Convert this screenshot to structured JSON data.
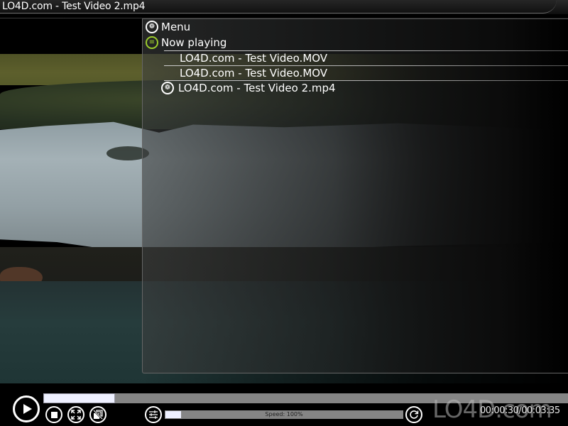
{
  "window": {
    "title": "LO4D.com - Test Video 2.mp4"
  },
  "menu": {
    "items": [
      {
        "label": "Menu",
        "icon": "flower-icon"
      },
      {
        "label": "Now playing",
        "icon": "list-icon",
        "accent": "#9ccc2c"
      }
    ],
    "playlist": [
      {
        "label": "LO4D.com - Test Video.MOV",
        "current": false
      },
      {
        "label": "LO4D.com - Test Video.MOV",
        "current": false
      },
      {
        "label": "LO4D.com - Test Video 2.mp4",
        "current": true
      }
    ]
  },
  "controls": {
    "seek_progress_fraction": 0.136,
    "speed_label": "Speed: 100%",
    "speed_fill_fraction": 0.07,
    "time_display": "00:00:30/00:03:35",
    "buttons": [
      "play",
      "stop",
      "fullscreen",
      "no-overlay",
      "equalizer",
      "repeat"
    ]
  },
  "watermark": {
    "text": "LO4D.com"
  }
}
